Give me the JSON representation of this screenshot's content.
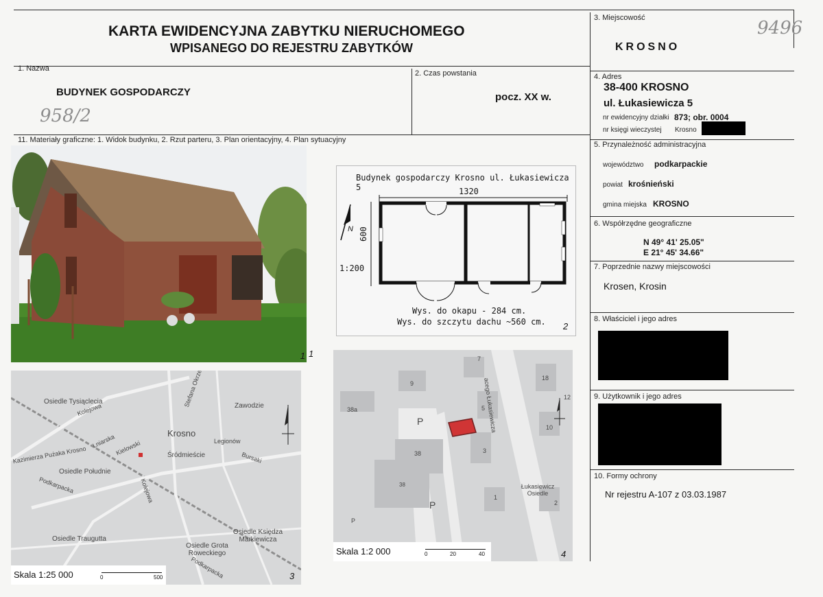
{
  "header": {
    "title_line1": "KARTA EWIDENCYJNA ZABYTKU NIERUCHOMEGO",
    "title_line2": "WPISANEGO DO REJESTRU ZABYTKÓW",
    "handwritten_number": "9496"
  },
  "field1": {
    "label": "1. Nazwa",
    "value": "BUDYNEK GOSPODARCZY",
    "handwritten": "958/2"
  },
  "field2": {
    "label": "2. Czas powstania",
    "value": "pocz. XX w."
  },
  "field3": {
    "label": "3. Miejscowość",
    "value": "KROSNO"
  },
  "field4": {
    "label": "4. Adres",
    "postal": "38-400  KROSNO",
    "street": "ul. Łukasiewicza 5",
    "parcel_label": "nr ewidencyjny działki",
    "parcel_value": "873; obr. 0004",
    "land_label": "nr księgi wieczystej",
    "land_value": "Krosno"
  },
  "field5": {
    "label": "5. Przynależność administracyjna",
    "voiv_label": "województwo",
    "voiv_value": "podkarpackie",
    "county_label": "powiat",
    "county_value": "krośnieński",
    "comm_label": "gmina miejska",
    "comm_value": "KROSNO"
  },
  "field6": {
    "label": "6. Współrzędne geograficzne",
    "n": "N 49° 41' 25.05\"",
    "e": "E 21° 45' 34.66\""
  },
  "field7": {
    "label": "7. Poprzednie nazwy miejscowości",
    "value": "Krosen, Krosin"
  },
  "field8": {
    "label": "8. Właściciel i jego adres"
  },
  "field9": {
    "label": "9. Użytkownik i jego adres"
  },
  "field10": {
    "label": "10. Formy ochrony",
    "value": "Nr rejestru A-107 z 03.03.1987"
  },
  "field11": {
    "label": "11. Materiały graficzne: 1. Widok budynku, 2. Rzut parteru, 3. Plan orientacyjny, 4. Plan sytuacyjny"
  },
  "photo": {
    "number": "1"
  },
  "plan": {
    "title": "Budynek gospodarczy Krosno ul. Łukasiewicza 5",
    "width_dim": "1320",
    "depth_dim": "600",
    "scale": "1:200",
    "north": "N",
    "note1": "Wys. do okapu - 284 cm.",
    "note2": "Wys. do szczytu dachu  ~560 cm.",
    "number": "2"
  },
  "map_orient": {
    "scale_label": "Skala 1:25 000",
    "bar_start": "0",
    "bar_end": "500",
    "number": "3",
    "labels": [
      "Osiedle Tysiąclecia",
      "Kolejowa",
      "Zawodzie",
      "Krosno",
      "Legionów",
      "Bursaki",
      "Śródmieście",
      "Kazimierza Pużaka Krosno",
      "Lniarska",
      "Kielowski",
      "Osiedle Południe",
      "Podkarpacka",
      "Osiedle Traugutta",
      "Osiedle Grota Roweckiego",
      "Osiedle Księdza Markiewicza",
      "Stefana Okrzei",
      "Podkarpacka",
      "Kolejowa"
    ]
  },
  "map_sit": {
    "scale_label": "Skala 1:2 000",
    "bar_start": "0",
    "bar_mid": "20",
    "bar_end": "40",
    "number": "4",
    "labels": [
      "acego Łukasiewicza",
      "Łukasiewicz Osiedle",
      "P",
      "P",
      "P",
      "38",
      "38",
      "38a",
      "5",
      "3",
      "7",
      "9",
      "18",
      "10",
      "12",
      "1",
      "2"
    ]
  }
}
